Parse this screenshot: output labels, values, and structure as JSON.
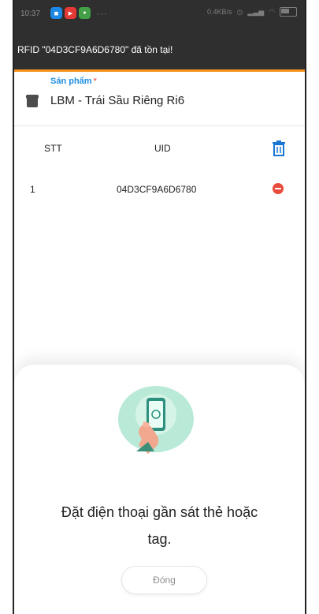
{
  "status_bar": {
    "time": "10:37",
    "net_speed": "0.4KB/s"
  },
  "toast": {
    "message": "RFID \"04D3CF9A6D6780\" đã tồn tại!"
  },
  "product": {
    "label": "Sản phẩm",
    "required_mark": "*",
    "value": "LBM - Trái Sầu Riêng Ri6"
  },
  "table": {
    "headers": {
      "stt": "STT",
      "uid": "UID"
    },
    "rows": [
      {
        "stt": "1",
        "uid": "04D3CF9A6D6780"
      }
    ]
  },
  "sheet": {
    "prompt_line1": "Đặt điện thoại gần sát thẻ hoặc",
    "prompt_line2": "tag.",
    "close_label": "Đóng"
  },
  "colors": {
    "accent_orange": "#f7931e",
    "label_blue": "#1d8fe1",
    "trash_blue": "#1976d2",
    "remove_red": "#e84a3b",
    "illustration_green": "#b9ead8"
  },
  "icons": {
    "product": "box-icon",
    "delete_all": "trash-icon",
    "remove_row": "minus-circle-icon",
    "illustration": "phone-nfc-illustration"
  }
}
